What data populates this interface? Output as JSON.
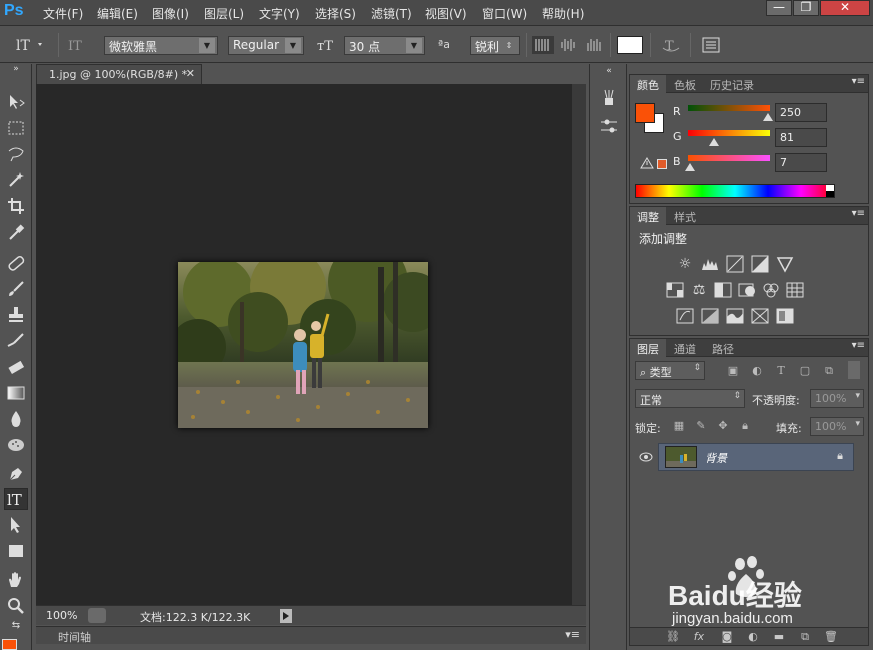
{
  "app": {
    "logo": "Ps"
  },
  "menu": [
    "文件(F)",
    "编辑(E)",
    "图像(I)",
    "图层(L)",
    "文字(Y)",
    "选择(S)",
    "滤镜(T)",
    "视图(V)",
    "窗口(W)",
    "帮助(H)"
  ],
  "window_controls": {
    "minimize": "—",
    "restore": "❐",
    "close": "✕"
  },
  "options": {
    "tool_icon": "type-tool-icon",
    "font_family": "微软雅黑",
    "font_style": "Regular",
    "font_size": "30 点",
    "aa_label": "ªa",
    "antialias": "锐利",
    "color_swatch": "#ffffff"
  },
  "document": {
    "tab_title": "1.jpg @ 100%(RGB/8#) *",
    "zoom": "100%",
    "doc_info": "文档:122.3 K/122.3K",
    "timeline_label": "时间轴"
  },
  "color_panel": {
    "tabs": [
      "颜色",
      "色板",
      "历史记录"
    ],
    "foreground": "#fa5107",
    "background": "#ffffff",
    "channels": [
      {
        "label": "R",
        "value": "250",
        "level": 0.98
      },
      {
        "label": "G",
        "value": "81",
        "level": 0.32
      },
      {
        "label": "B",
        "value": "7",
        "level": 0.03
      }
    ]
  },
  "adjust_panel": {
    "tabs": [
      "调整",
      "样式"
    ],
    "heading": "添加调整"
  },
  "layers_panel": {
    "tabs": [
      "图层",
      "通道",
      "路径"
    ],
    "filter_kind": "类型",
    "blend_mode": "正常",
    "opacity_label": "不透明度:",
    "opacity_value": "100%",
    "lock_label": "锁定:",
    "fill_label": "填充:",
    "fill_value": "100%",
    "layer_name": "背景"
  },
  "watermark": {
    "brand": "Baidu经验",
    "url": "jingyan.baidu.com"
  }
}
